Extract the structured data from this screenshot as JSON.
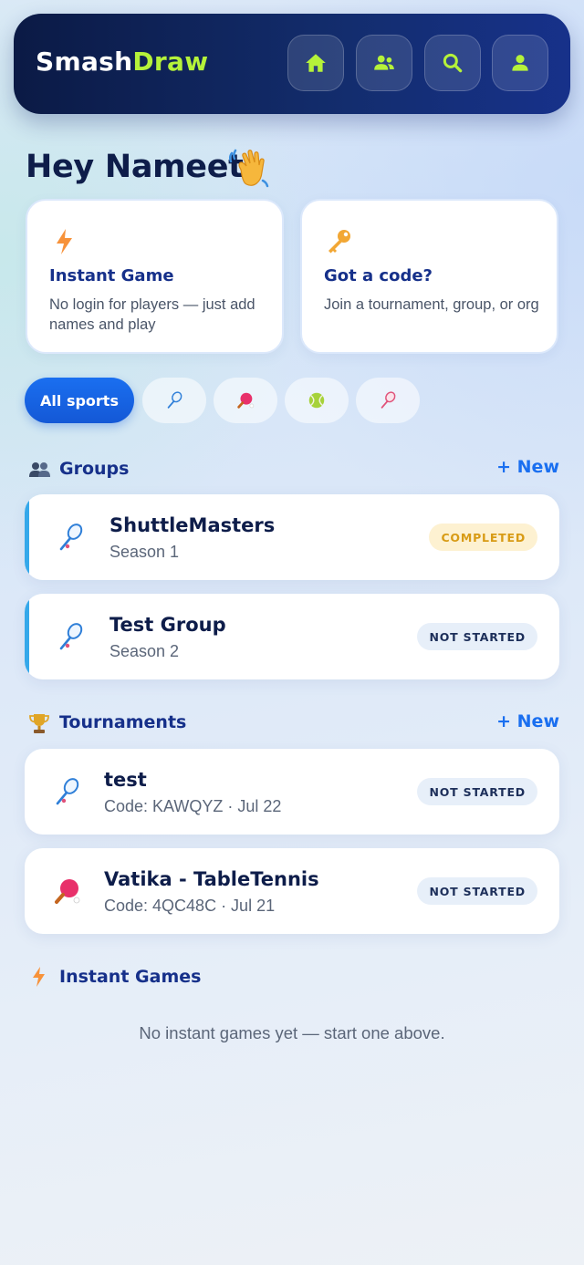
{
  "header": {
    "logo_part1": "Smash",
    "logo_part2": "Draw",
    "nav": [
      "home-icon",
      "groups-icon",
      "search-icon",
      "profile-icon"
    ]
  },
  "greeting": "Hey Nameet",
  "quick_actions": [
    {
      "icon": "lightning-icon",
      "title": "Instant Game",
      "desc": "No login for players — just add names and play"
    },
    {
      "icon": "key-icon",
      "title": "Got a code?",
      "desc": "Join a tournament, group, or org"
    }
  ],
  "sport_filters": {
    "active_label": "All sports",
    "icons": [
      "badminton-icon",
      "table-tennis-icon",
      "tennis-ball-icon",
      "racket-icon"
    ]
  },
  "groups": {
    "title": "Groups",
    "new_label": "+ New",
    "items": [
      {
        "name": "ShuttleMasters",
        "sub": "Season 1",
        "status": "COMPLETED"
      },
      {
        "name": "Test Group",
        "sub": "Season 2",
        "status": "NOT STARTED"
      }
    ]
  },
  "tournaments": {
    "title": "Tournaments",
    "new_label": "+ New",
    "items": [
      {
        "name": "test",
        "sub": "Code: KAWQYZ · Jul 22",
        "status": "NOT STARTED"
      },
      {
        "name": "Vatika - TableTennis",
        "sub": "Code: 4QC48C · Jul 21",
        "status": "NOT STARTED"
      }
    ]
  },
  "instant_games": {
    "title": "Instant Games",
    "empty_text": "No instant games yet — start one above."
  },
  "colors": {
    "header_bg": "#0b1a45",
    "brand_accent": "#b5f23a",
    "primary": "#1a6ff0",
    "completed": "#d89b15"
  }
}
